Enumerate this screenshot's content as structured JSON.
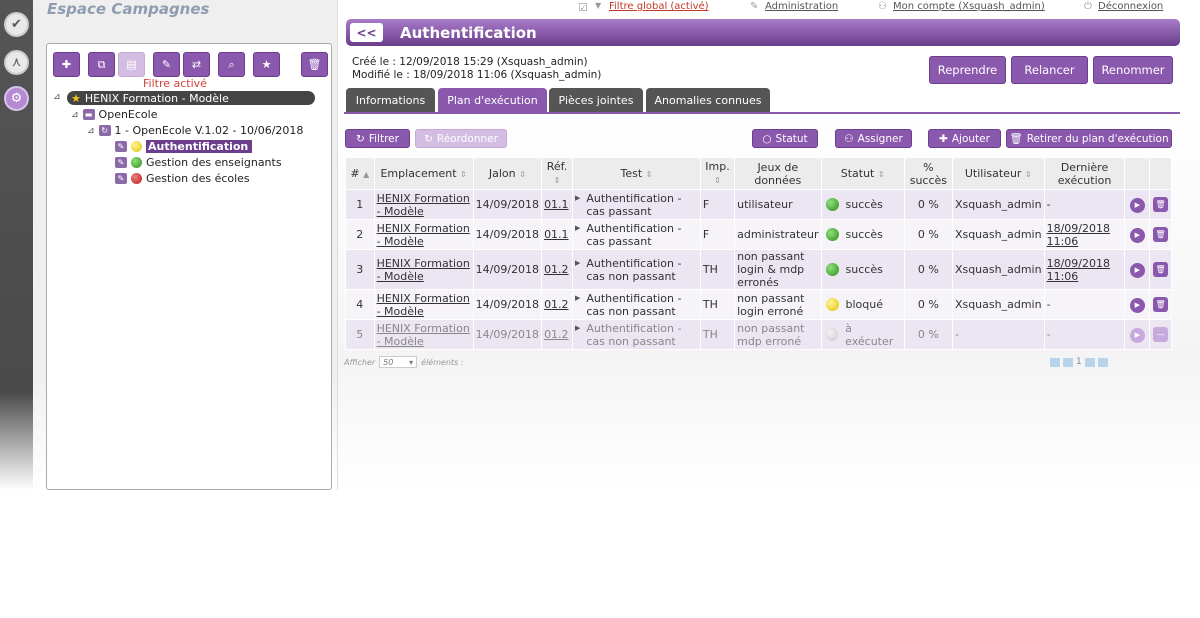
{
  "workspace": {
    "title": "Espace Campagnes"
  },
  "topbar": {
    "global_filter": "Filtre global (activé)",
    "administration": "Administration",
    "account": "Mon compte (Xsquash_admin)",
    "logout": "Déconnexion"
  },
  "rail": {
    "icons": [
      "check-circle-icon",
      "workflow-icon",
      "campaign-gears-icon"
    ]
  },
  "tree": {
    "filter_active": "Filtre activé",
    "toolbar": [
      "add",
      "copy",
      "paste",
      "rename",
      "move",
      "search",
      "favorite",
      "delete"
    ],
    "root": "HENIX Formation - Modèle",
    "project": "OpenEcole",
    "iteration": "1 - OpenEcole V.1.02 - 10/06/2018",
    "suites": [
      {
        "label": "Authentification",
        "status": "yellow",
        "selected": true
      },
      {
        "label": "Gestion des enseignants",
        "status": "green",
        "selected": false
      },
      {
        "label": "Gestion des écoles",
        "status": "red",
        "selected": false
      }
    ]
  },
  "header": {
    "back": "<<",
    "title": "Authentification",
    "created": "Créé le :  12/09/2018 15:29 (Xsquash_admin)",
    "modified": "Modifié le :  18/09/2018 11:06 (Xsquash_admin)",
    "buttons": {
      "resume": "Reprendre",
      "relaunch": "Relancer",
      "rename": "Renommer"
    }
  },
  "tabs": [
    "Informations",
    "Plan d'exécution",
    "Pièces jointes",
    "Anomalies connues"
  ],
  "plan_toolbar": {
    "filter": "Filtrer",
    "reorder": "Réordonner",
    "status": "Statut",
    "assign": "Assigner",
    "add": "Ajouter",
    "remove": "Retirer du plan d'exécution"
  },
  "table": {
    "headers": [
      "#",
      "Emplacement",
      "Jalon",
      "Réf.",
      "Test",
      "Imp.",
      "Jeux de données",
      "Statut",
      "% succès",
      "Utilisateur",
      "Dernière exécution"
    ],
    "rows": [
      {
        "num": "1",
        "location": "HENIX Formation - Modèle",
        "milestone": "14/09/2018",
        "ref": "01.1",
        "test": "Authentification - cas passant",
        "imp": "F",
        "dataset": "utilisateur",
        "status": "succès",
        "status_color": "green",
        "pct": "0 %",
        "user": "Xsquash_admin",
        "last": "-"
      },
      {
        "num": "2",
        "location": "HENIX Formation - Modèle",
        "milestone": "14/09/2018",
        "ref": "01.1",
        "test": "Authentification - cas passant",
        "imp": "F",
        "dataset": "administrateur",
        "status": "succès",
        "status_color": "green",
        "pct": "0 %",
        "user": "Xsquash_admin",
        "last": "18/09/2018 11:06"
      },
      {
        "num": "3",
        "location": "HENIX Formation - Modèle",
        "milestone": "14/09/2018",
        "ref": "01.2",
        "test": "Authentification - cas non passant",
        "imp": "TH",
        "dataset": "non passant login & mdp erronés",
        "status": "succès",
        "status_color": "green",
        "pct": "0 %",
        "user": "Xsquash_admin",
        "last": "18/09/2018 11:06"
      },
      {
        "num": "4",
        "location": "HENIX Formation - Modèle",
        "milestone": "14/09/2018",
        "ref": "01.2",
        "test": "Authentification - cas non passant",
        "imp": "TH",
        "dataset": "non passant login erroné",
        "status": "bloqué",
        "status_color": "yellow",
        "pct": "0 %",
        "user": "Xsquash_admin",
        "last": "-"
      },
      {
        "num": "5",
        "location": "HENIX Formation - Modèle",
        "milestone": "14/09/2018",
        "ref": "01.2",
        "test": "Authentification - cas non passant",
        "imp": "TH",
        "dataset": "non passant mdp erroné",
        "status": "à exécuter",
        "status_color": "grey",
        "pct": "0 %",
        "user": "-",
        "last": "-"
      }
    ]
  },
  "footer": {
    "show": "Afficher",
    "page_size": "50",
    "elements": "éléments :",
    "page": "1"
  }
}
